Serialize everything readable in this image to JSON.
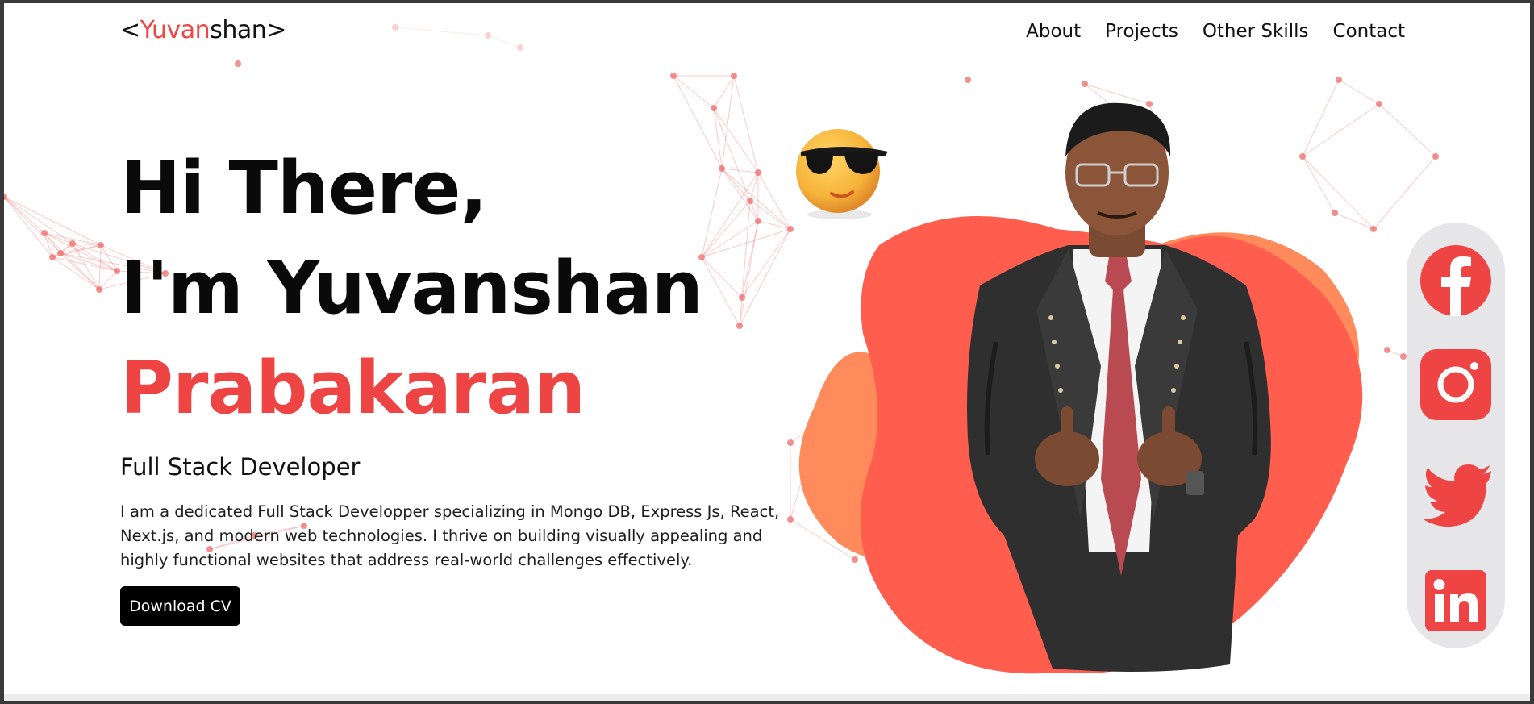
{
  "logo": {
    "open": "<",
    "highlight": "Yuvan",
    "rest": "shan",
    "close": ">"
  },
  "nav": {
    "items": [
      "About",
      "Projects",
      "Other Skills",
      "Contact"
    ]
  },
  "hero": {
    "line1": "Hi There,",
    "line2": "I'm Yuvanshan",
    "line3": "Prabakaran",
    "subtitle": "Full Stack Developer",
    "description": "I am a dedicated Full Stack Developper specializing in Mongo DB, Express Js, React, Next.js, and modern web technologies. I thrive on building visually appealing and highly functional websites that address real-world challenges effectively.",
    "cta": "Download CV"
  },
  "social": [
    "facebook-icon",
    "instagram-icon",
    "twitter-icon",
    "linkedin-icon"
  ],
  "colors": {
    "accent": "#ef4444",
    "blob_main": "#ff5e4e",
    "blob_light": "#ff8a5c",
    "network": "#ef6b6b",
    "button_bg": "#000000",
    "social_bg": "#e6e6e9"
  }
}
